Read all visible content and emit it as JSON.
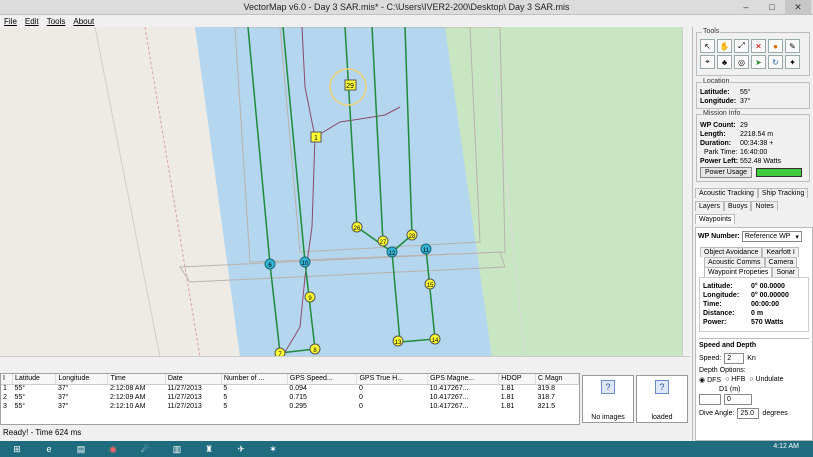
{
  "window": {
    "title": "VectorMap v6.0 - Day 3 SAR.mis* - C:\\Users\\IVER2-200\\Desktop\\ Day 3 SAR.mis"
  },
  "menu": {
    "file": "File",
    "edit": "Edit",
    "tools": "Tools",
    "about": "About"
  },
  "map": {
    "waypoints": [
      "1",
      "29",
      "26",
      "27",
      "28",
      "6",
      "10",
      "9",
      "7",
      "8",
      "12",
      "11",
      "15",
      "16",
      "13",
      "14"
    ],
    "colors": {
      "water": "#b4d6ee",
      "land": "#eeebe5",
      "park": "#c9e6c2",
      "track": "#1e8c3a",
      "path": "#8b4a6a"
    }
  },
  "grid": {
    "headers": [
      "I",
      "Latitude",
      "Longitude",
      "Time",
      "Date",
      "Number of ...",
      "GPS Speed...",
      "GPS True H...",
      "GPS Magne...",
      "HDOP",
      "C Magn"
    ],
    "rows": [
      [
        "1",
        "55°",
        "37°",
        "2:12:08 AM",
        "11/27/2013",
        "5",
        "0.094",
        "0",
        "10.417267...",
        "1.81",
        "319.8"
      ],
      [
        "2",
        "55°",
        "37°",
        "2:12:09 AM",
        "11/27/2013",
        "5",
        "0.715",
        "0",
        "10.417267...",
        "1.81",
        "318.7"
      ],
      [
        "3",
        "55°",
        "37°",
        "2:12:10 AM",
        "11/27/2013",
        "5",
        "0.295",
        "0",
        "10.417267...",
        "1.81",
        "321.5"
      ]
    ]
  },
  "images": {
    "left_label": "No images",
    "right_label": "loaded"
  },
  "status": "Ready! - Time 624 ms",
  "taskbar": {
    "clock": "4:12 AM"
  },
  "panel": {
    "tools_label": "Tools",
    "location_label": "Location",
    "latitude_label": "Latitude:",
    "latitude_value": "55°",
    "longitude_label": "Longitude:",
    "longitude_value": "37°",
    "mission_label": "Mission Info",
    "wp_count_label": "WP Count:",
    "wp_count_value": "29",
    "length_label": "Length:",
    "length_value": "2218.54 m",
    "duration_label": "Duration:",
    "duration_value": "00:34:38 +",
    "park_time_label": "Park Time:",
    "park_time_value": "16:40:00",
    "power_left_label": "Power Left:",
    "power_left_value": "552.48 Watts",
    "power_usage_button": "Power Usage",
    "tabs1": [
      "Acoustic Tracking",
      "Ship Tracking"
    ],
    "tabs2": [
      "Layers",
      "Buoys",
      "Notes"
    ],
    "waypoints_tab": "Waypoints",
    "wp_number_label": "WP Number:",
    "wp_number_value": "Reference WP",
    "subtabs1": [
      "Object Avoidance",
      "Kearfott I"
    ],
    "subtabs2": [
      "Acoustic Comms",
      "Camera"
    ],
    "subtabs3": [
      "Waypoint Propeties",
      "Sonar"
    ],
    "wp_latitude_label": "Latitude:",
    "wp_latitude_value": "0° 00.0000",
    "wp_longitude_label": "Longitude:",
    "wp_longitude_value": "0° 00.00000",
    "wp_time_label": "Time:",
    "wp_time_value": "00:00:00",
    "wp_distance_label": "Distance:",
    "wp_distance_value": "0 m",
    "wp_power_label": "Power:",
    "wp_power_value": "570 Watts",
    "speed_depth_label": "Speed and Depth",
    "speed_label": "Speed:",
    "speed_value": "2",
    "speed_unit": "Kn",
    "depth_options_label": "Depth Options:",
    "dfs_label": "DFS",
    "hfb_label": "HFB",
    "undulate_label": "Undulate",
    "d1_label": "D1 (m)",
    "d1_value": "0",
    "dive_angle_label": "Dive Angle:",
    "dive_angle_value": "25.0",
    "degrees_label": "degrees"
  }
}
